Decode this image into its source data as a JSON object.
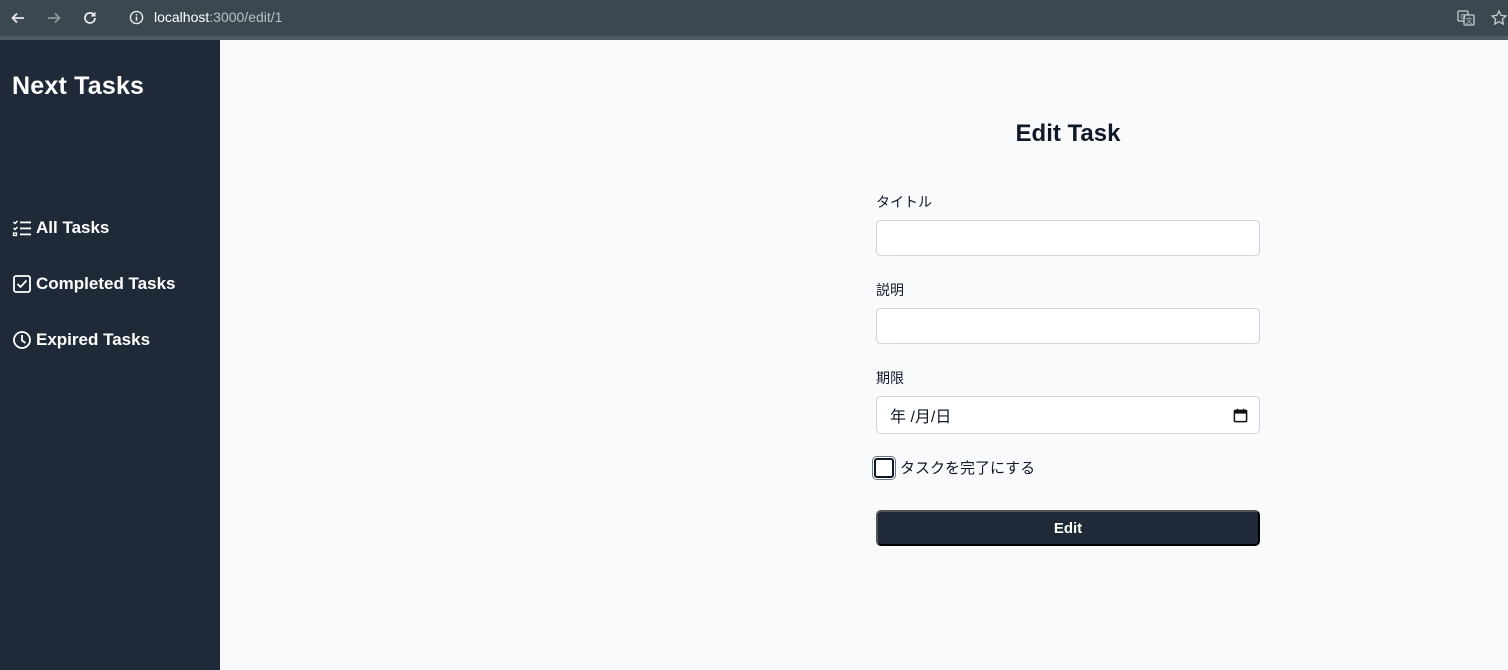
{
  "browser": {
    "url_host": "localhost",
    "url_path": ":3000/edit/1",
    "icons": [
      "back-arrow-icon",
      "forward-arrow-icon",
      "reload-icon",
      "site-info-icon",
      "translate-icon",
      "bookmark-star-icon"
    ]
  },
  "sidebar": {
    "brand": "Next Tasks",
    "items": [
      {
        "label": "All Tasks",
        "icon": "checklist-icon"
      },
      {
        "label": "Completed Tasks",
        "icon": "checkbox-checked-icon"
      },
      {
        "label": "Expired Tasks",
        "icon": "clock-icon"
      }
    ]
  },
  "form": {
    "title": "Edit Task",
    "title_label": "タイトル",
    "title_value": "",
    "description_label": "説明",
    "description_value": "",
    "due_label": "期限",
    "due_placeholder": "年 /月/日",
    "completed_label": "タスクを完了にする",
    "completed_checked": false,
    "submit_label": "Edit"
  },
  "colors": {
    "sidebar_bg": "#1f2937",
    "main_bg": "#f8fafc",
    "button_bg": "#1f2937",
    "browser_bar": "#3c4850"
  }
}
